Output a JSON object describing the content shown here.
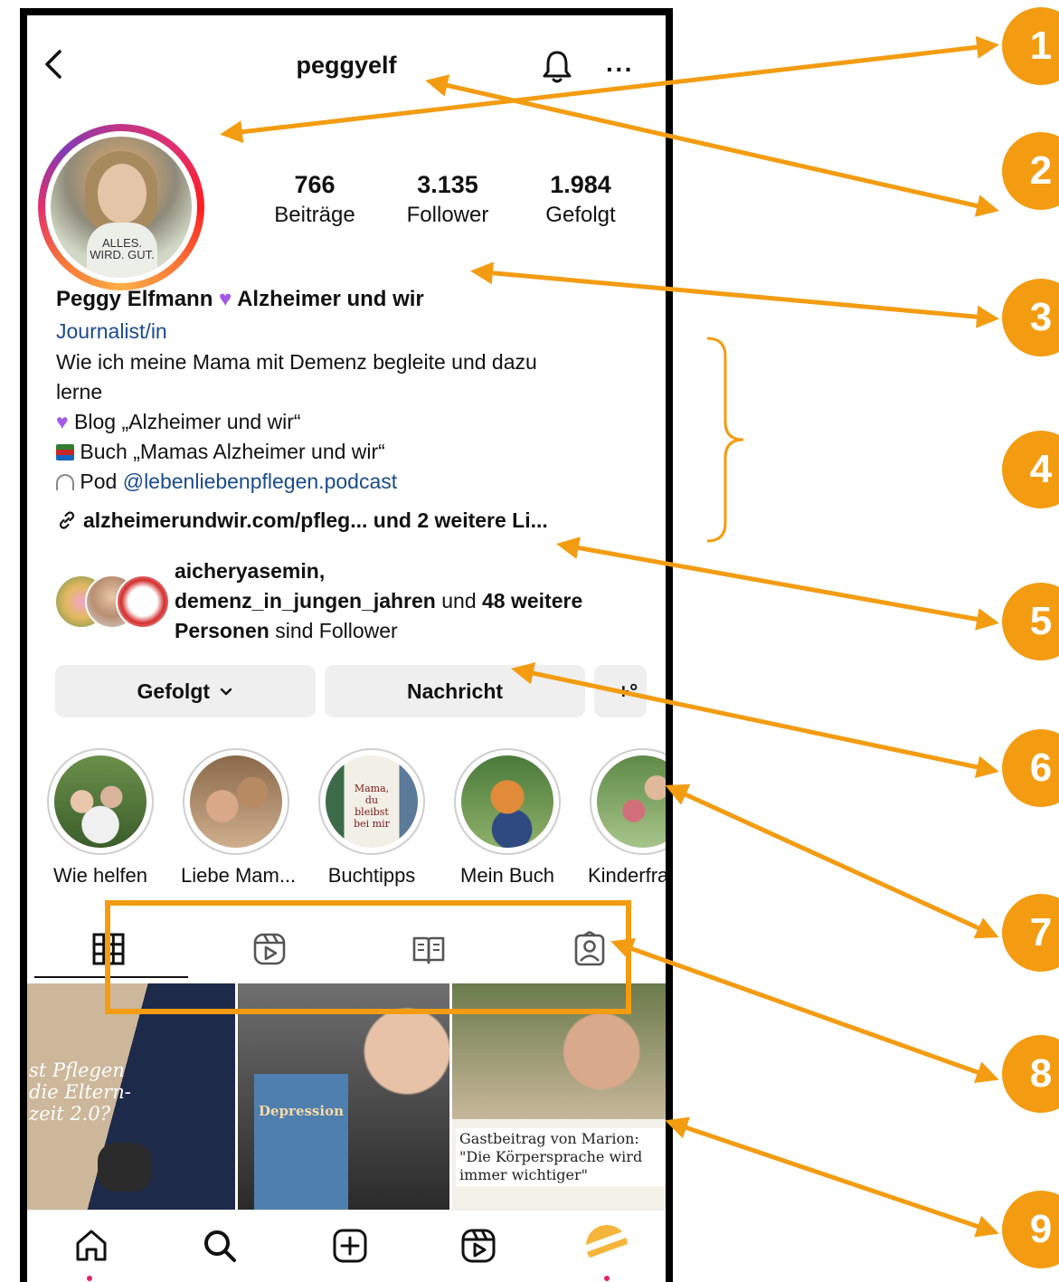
{
  "header": {
    "username": "peggyelf",
    "more_label": "···"
  },
  "stats": [
    {
      "value": "766",
      "label": "Beiträge"
    },
    {
      "value": "3.135",
      "label": "Follower"
    },
    {
      "value": "1.984",
      "label": "Gefolgt"
    }
  ],
  "profile": {
    "name": "Peggy Elfmann",
    "name_suffix": "Alzheimer und wir",
    "category": "Journalist/in",
    "bio_line1": "Wie ich meine Mama mit Demenz begleite und dazu",
    "bio_line2": "lerne",
    "bio_line3": "Blog „Alzheimer und wir“",
    "bio_line4": "Buch „Mamas Alzheimer und wir“",
    "bio_line5_prefix": "Pod",
    "bio_line5_link": "@lebenliebenpflegen.podcast",
    "link_text": "alzheimerundwir.com/pfleg...  und 2 weitere Li...",
    "avatar_shirt_text": "ALLES. WIRD. GUT."
  },
  "followed_by": {
    "user1": "aicheryasemin,",
    "user2": "demenz_in_jungen_jahren",
    "and": " und ",
    "count": "48 weitere",
    "persons": "Personen",
    "suffix": " sind Follower"
  },
  "buttons": {
    "followed": "Gefolgt",
    "message": "Nachricht",
    "add_user": "+°"
  },
  "highlights": [
    {
      "label": "Wie helfen"
    },
    {
      "label": "Liebe Mam..."
    },
    {
      "label": "Buchtipps"
    },
    {
      "label": "Mein Buch"
    },
    {
      "label": "Kinderfra"
    }
  ],
  "highlight_book_text": "Mama, du bleibst bei mir",
  "grid": [
    {
      "text": "st Pflegen die Eltern- zeit 2.0?"
    },
    {
      "text": "Depression"
    },
    {
      "text": "Gastbeitrag von Marion: \"Die Körpersprache wird immer wichtiger\""
    }
  ],
  "annotations": [
    "1",
    "2",
    "3",
    "4",
    "5",
    "6",
    "7",
    "8",
    "9"
  ],
  "colors": {
    "annotation_orange": "#f39c12",
    "link_blue": "#1a4b8c",
    "button_gray": "#efefef",
    "heart_purple": "#a259e6"
  }
}
